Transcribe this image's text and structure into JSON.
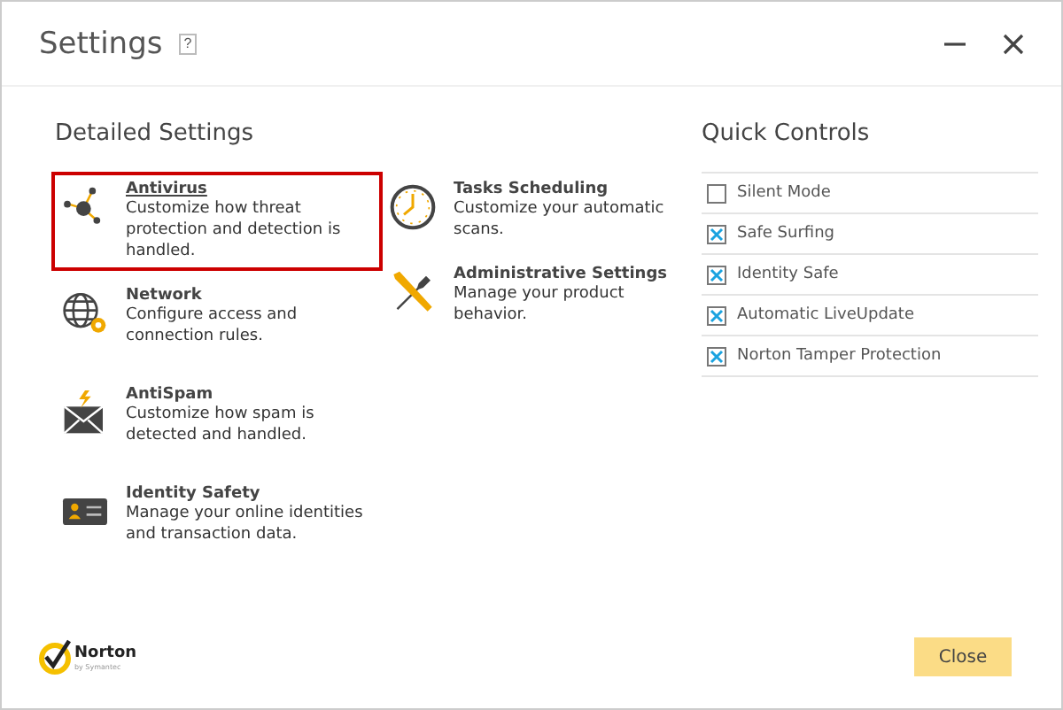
{
  "window": {
    "title": "Settings",
    "help": "?"
  },
  "detailed_settings": {
    "heading": "Detailed Settings",
    "columns": [
      [
        {
          "kind": "antivirus",
          "title": "Antivirus",
          "description": "Customize how threat protection and detection is handled.",
          "selected": true
        },
        {
          "kind": "network",
          "title": "Network",
          "description": "Configure access and connection rules.",
          "selected": false
        },
        {
          "kind": "antispam",
          "title": "AntiSpam",
          "description": "Customize how spam is detected and handled.",
          "selected": false
        },
        {
          "kind": "identity",
          "title": "Identity Safety",
          "description": "Manage your online identities and transaction data.",
          "selected": false
        }
      ],
      [
        {
          "kind": "clock",
          "title": "Tasks Scheduling",
          "description": "Customize your automatic scans.",
          "selected": false
        },
        {
          "kind": "admin",
          "title": "Administrative Settings",
          "description": "Manage your product behavior.",
          "selected": false
        }
      ]
    ]
  },
  "quick_controls": {
    "heading": "Quick Controls",
    "items": [
      {
        "label": "Silent Mode",
        "checked": false
      },
      {
        "label": "Safe Surfing",
        "checked": true
      },
      {
        "label": "Identity Safe",
        "checked": true
      },
      {
        "label": "Automatic LiveUpdate",
        "checked": true
      },
      {
        "label": "Norton Tamper Protection",
        "checked": true
      }
    ]
  },
  "logo": {
    "name": "Norton",
    "tagline": "by Symantec"
  },
  "buttons": [
    "Close"
  ]
}
